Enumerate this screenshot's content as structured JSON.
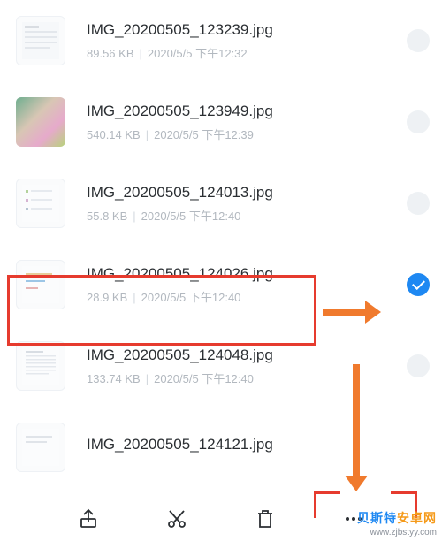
{
  "files": [
    {
      "name": "IMG_20200505_123239.jpg",
      "size": "89.56 KB",
      "date": "2020/5/5 下午12:32",
      "selected": false
    },
    {
      "name": "IMG_20200505_123949.jpg",
      "size": "540.14 KB",
      "date": "2020/5/5 下午12:39",
      "selected": false
    },
    {
      "name": "IMG_20200505_124013.jpg",
      "size": "55.8 KB",
      "date": "2020/5/5 下午12:40",
      "selected": false
    },
    {
      "name": "IMG_20200505_124026.jpg",
      "size": "28.9 KB",
      "date": "2020/5/5 下午12:40",
      "selected": true
    },
    {
      "name": "IMG_20200505_124048.jpg",
      "size": "133.74 KB",
      "date": "2020/5/5 下午12:40",
      "selected": false
    },
    {
      "name": "IMG_20200505_124121.jpg",
      "size": "",
      "date": "",
      "selected": false
    }
  ],
  "watermark": {
    "title_a": "贝斯特",
    "title_b": "安卓网",
    "url": "www.zjbstyy.com"
  }
}
